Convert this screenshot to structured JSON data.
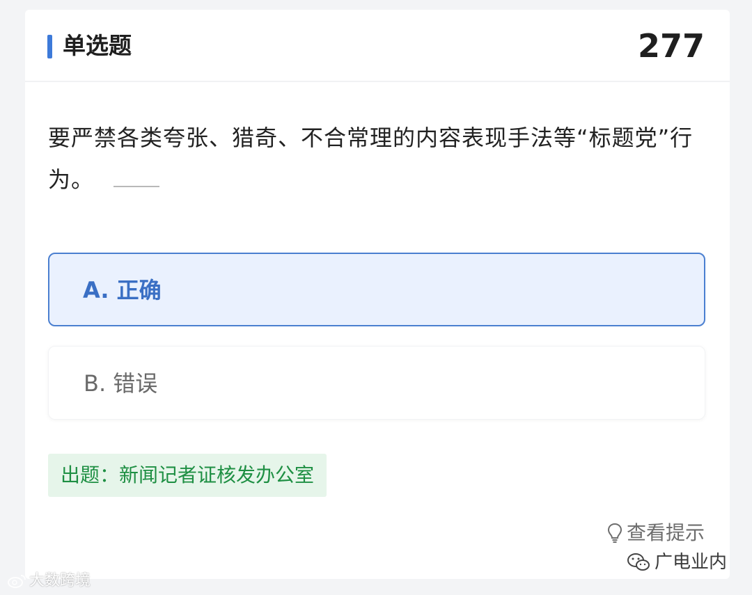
{
  "header": {
    "question_type": "单选题",
    "question_count": "277"
  },
  "question": {
    "text": "要严禁各类夸张、猎奇、不合常理的内容表现手法等“标题党”行为。"
  },
  "options": [
    {
      "label": "A. 正确",
      "selected": true
    },
    {
      "label": "B. 错误",
      "selected": false
    }
  ],
  "source": {
    "text": "出题：新闻记者证核发办公室"
  },
  "hint": {
    "label": "查看提示",
    "icon": "lightbulb-icon"
  },
  "watermarks": {
    "left": "大数跨境",
    "right": "广电业内",
    "left_icon": "weibo-icon",
    "right_icon": "wechat-icon"
  },
  "colors": {
    "accent": "#3d7ad9",
    "selected_bg": "#eaf1fe",
    "source_green": "#1e8f43",
    "source_bg": "#e6f5ea"
  }
}
